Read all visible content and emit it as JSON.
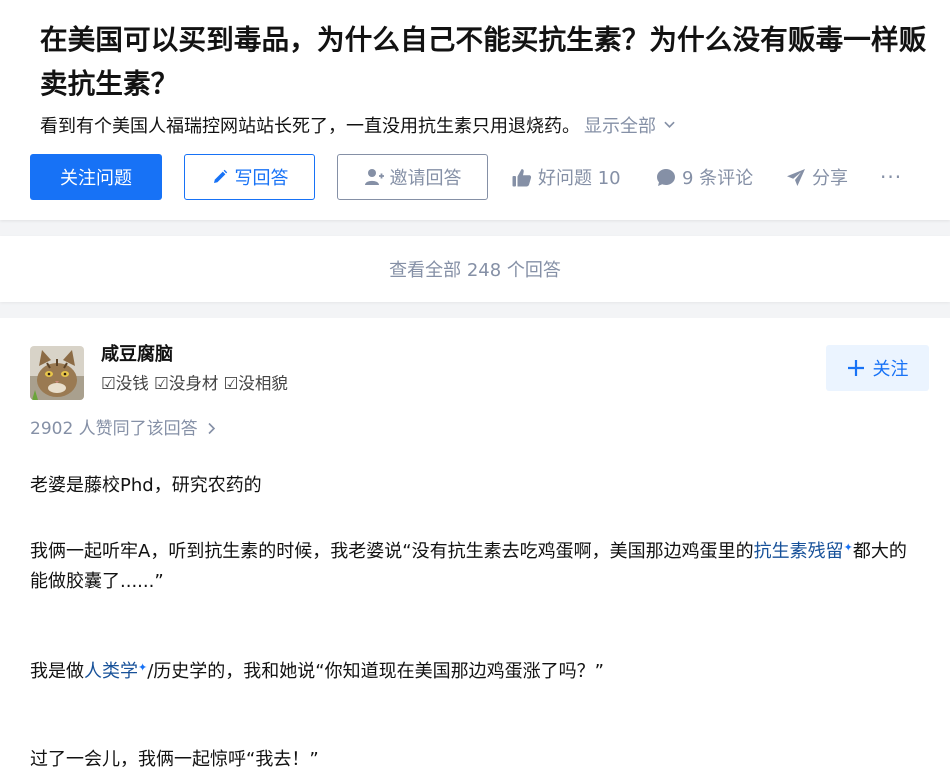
{
  "question": {
    "title": "在美国可以买到毒品，为什么自己不能买抗生素？为什么没有贩毒一样贩卖抗生素？",
    "detail": "看到有个美国人福瑞控网站站长死了，一直没用抗生素只用退烧药。",
    "show_all": "显示全部",
    "follow_label": "关注问题",
    "write_label": "写回答",
    "invite_label": "邀请回答",
    "good_label": "好问题 10",
    "comment_label": "9 条评论",
    "share_label": "分享",
    "more_label": "···"
  },
  "view_all": "查看全部 248 个回答",
  "answer": {
    "author_name": "咸豆腐脑",
    "author_bio": "☑没钱 ☑没身材 ☑没相貌",
    "follow_label": "关注",
    "voters": "2902 人赞同了该回答",
    "p1": "老婆是藤校Phd，研究农药的",
    "p2_a": "我俩一起听牢A，听到抗生素的时候，我老婆说“没有抗生素去吃鸡蛋啊，美国那边鸡蛋里的",
    "p2_link": "抗生素残留",
    "p2_b": "都大的能做胶囊了......”",
    "p3_a": "我是做",
    "p3_link": "人类学",
    "p3_b": "/历史学的，我和她说“你知道现在美国那边鸡蛋涨了吗？”",
    "p4": "过了一会儿，我俩一起惊呼“我去！”"
  },
  "colors": {
    "accent": "#1772f6",
    "muted": "#8590a6",
    "link": "#175199",
    "background": "#f3f4f6"
  },
  "icons": [
    "pencil-icon",
    "invite-user-icon",
    "thumb-up-icon",
    "comment-bubble-icon",
    "paper-plane-icon",
    "chevron-down-icon",
    "plus-icon",
    "chevron-right-icon",
    "sparkle-icon"
  ]
}
